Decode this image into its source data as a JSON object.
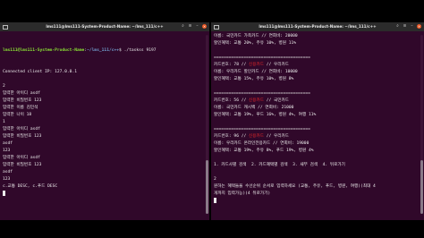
{
  "left": {
    "title": "lms111@lms111-System-Product-Name: ~/lms_111/c++",
    "prompt_user": "lms111@lms111-System-Product-Name",
    "prompt_path": "~/lms_111/c++",
    "command": "$ ./taskss 9197",
    "lines": [
      "Connected client IP: 127.0.0.1",
      "",
      "2",
      "입력한 아이디 asdf",
      "입력한 비밀번호 123",
      "입력한 이름 김민석",
      "입력한 나이 18",
      "1",
      "입력한 아이디 asdf",
      "입력한 비밀번호 123",
      "asdf",
      "123",
      "입력한 아이디 asdf",
      "입력한 비밀번호 123",
      "asdf",
      "123",
      "c.교통 DESC, c.푸드 DESC"
    ]
  },
  "right": {
    "title": "lms111@lms111-System-Product-Name: ~/lms_111/c++",
    "lines": [
      {
        "t": "이름: 국민카드 가족카드 // 연회비: 20000"
      },
      {
        "t": "할인혜택: 교통 20%, 주유 10%, 병원 11%"
      },
      {
        "t": ""
      },
      {
        "t": "======================================="
      },
      {
        "pre": "카드번호: 78 // ",
        "red": "신용카드",
        "post": " // 우리카드"
      },
      {
        "t": "이름: 우리카드 할인카드 // 연회비: 10000"
      },
      {
        "t": "할인혜택: 교통 15%, 주유 10%, 병원 8%"
      },
      {
        "t": ""
      },
      {
        "t": "======================================="
      },
      {
        "pre": "카드번호: 56 // ",
        "red": "신용카드",
        "post": " // 국민카드"
      },
      {
        "t": "이름: 국민카드 캐시백 // 연회비: 21000"
      },
      {
        "t": "할인혜택: 교통 19%, 푸드 16%, 병원 4%, 여행 11%"
      },
      {
        "t": ""
      },
      {
        "t": "======================================="
      },
      {
        "pre": "카드번호: 96 // ",
        "red": "신용카드",
        "post": " // 우리카드"
      },
      {
        "t": "이름: 우리카드 온라인전용카드 // 연회비: 19000"
      },
      {
        "t": "할인혜택: 교통 19%, 주유 8%, 푸드 19%, 병원 4%"
      },
      {
        "t": ""
      },
      {
        "t": "1. 카드사별 검색  2. 카드혜택별 검색  3. 새부 검색  4. 뒤로가기"
      },
      {
        "t": ""
      },
      {
        "t": "2"
      },
      {
        "t": "원하는 혜택들을 수선순위 순서로 입력하세요 (교통, 주유, 푸드, 병원, 여행)(최대 4"
      },
      {
        "t": "개까지 입력가능)(4 뒤로가기)"
      }
    ]
  }
}
